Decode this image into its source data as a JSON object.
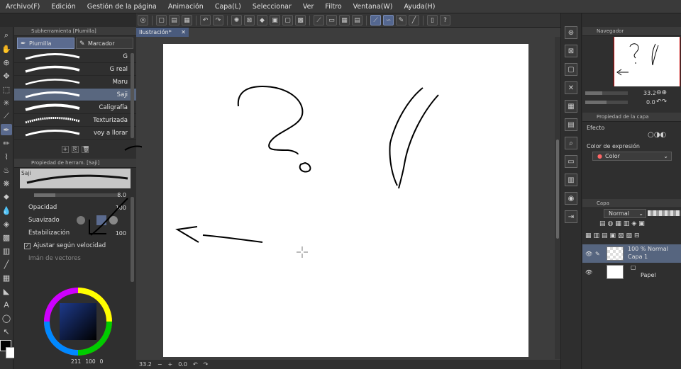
{
  "menu": [
    "Archivo(F)",
    "Edición",
    "Gestión de la página",
    "Animación",
    "Capa(L)",
    "Seleccionar",
    "Ver",
    "Filtro",
    "Ventana(W)",
    "Ayuda(H)"
  ],
  "left": {
    "subtool_title": "Subherramienta [Plumilla]",
    "tabs": [
      "Plumilla",
      "Marcador"
    ],
    "brushes": [
      "G",
      "G real",
      "Maru",
      "Saji",
      "Caligrafía",
      "Texturizada",
      "voy  a llorar"
    ],
    "selected_brush_index": 3,
    "prop_title": "Propiedad de herram. [Saji]",
    "preview_name": "Saji",
    "size_value": "8.0",
    "opacity_label": "Opacidad",
    "opacity_value": "100",
    "smoothing_label": "Suavizado",
    "stabilization_label": "Estabilización",
    "stabilization_value": "100",
    "speed_label": "Ajustar según velocidad",
    "vector_magnet_label": "Imán de vectores",
    "color_readout": [
      "211",
      "100",
      "0"
    ]
  },
  "canvas": {
    "tab_label": "Ilustración*",
    "zoom": "33.2",
    "rotation": "0.0"
  },
  "right": {
    "navigator_title": "Navegador",
    "nav_zoom": "33.2",
    "nav_rotation": "0.0",
    "layer_prop_title": "Propiedad de la capa",
    "effect_label": "Efecto",
    "expression_label": "Color de expresión",
    "expression_value": "Color",
    "layer_title": "Capa",
    "blend_mode": "Normal",
    "layers": [
      {
        "line1": "100 % Normal",
        "line2": "Capa 1"
      },
      {
        "line1": "",
        "line2": "Papel"
      }
    ]
  },
  "colors": {
    "ui_bg": "#2f2f2f",
    "selected": "#56657f",
    "accent": "#546790"
  }
}
